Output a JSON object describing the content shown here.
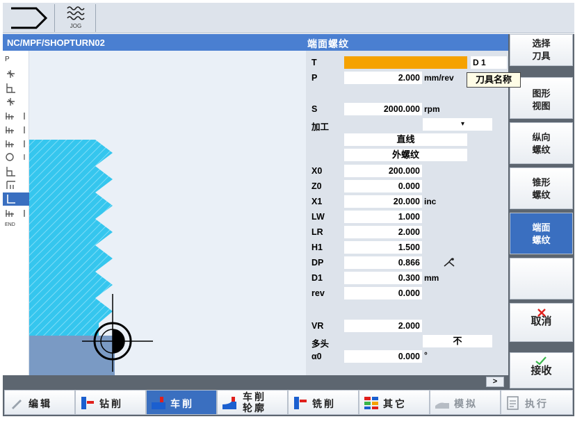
{
  "topbar": {
    "jog_label": "JOG"
  },
  "header": {
    "program_path": "NC/MPF/SHOPTURN02",
    "cycle_title": "端面螺纹"
  },
  "icon_column": {
    "first_label": "P",
    "last_label": "END"
  },
  "parameters": {
    "t_label": "T",
    "t_value": "",
    "d_label": "D 1",
    "tooltip": "刀具名称",
    "rows": [
      {
        "label": "P",
        "value": "2.000",
        "unit": "mm/rev"
      },
      {
        "label": "S",
        "value": "2000.000",
        "unit": "rpm"
      },
      {
        "label": "X0",
        "value": "200.000",
        "unit": ""
      },
      {
        "label": "Z0",
        "value": "0.000",
        "unit": ""
      },
      {
        "label": "X1",
        "value": "20.000",
        "unit": "inc"
      },
      {
        "label": "LW",
        "value": "1.000",
        "unit": ""
      },
      {
        "label": "LR",
        "value": "2.000",
        "unit": ""
      },
      {
        "label": "H1",
        "value": "1.500",
        "unit": ""
      },
      {
        "label": "DP",
        "value": "0.866",
        "unit": ""
      },
      {
        "label": "D1",
        "value": "0.300",
        "unit": "mm"
      },
      {
        "label": "rev",
        "value": "0.000",
        "unit": ""
      },
      {
        "label": "VR",
        "value": "2.000",
        "unit": ""
      },
      {
        "label": "α0",
        "value": "0.000",
        "unit": "°"
      }
    ],
    "machining_label": "加工",
    "machining_dropdown": "▾",
    "thread_type": "直线",
    "thread_position": "外螺纹",
    "multi_start_label": "多头",
    "multi_start_value": "不"
  },
  "vertical_softkeys": [
    {
      "line1": "选择",
      "line2": "刀具"
    },
    {
      "line1": "图形",
      "line2": "视图"
    },
    {
      "line1": "纵向",
      "line2": "螺纹"
    },
    {
      "line1": "锥形",
      "line2": "螺纹"
    },
    {
      "line1": "端面",
      "line2": "螺纹"
    },
    {
      "line1": "",
      "line2": ""
    },
    {
      "line1": "取消",
      "line2": ""
    },
    {
      "line1": "接收",
      "line2": ""
    }
  ],
  "status": {
    "more_label": ">"
  },
  "horizontal_softkeys": [
    {
      "label": "编辑"
    },
    {
      "label": "钻削"
    },
    {
      "label": "车削"
    },
    {
      "label1": "车削",
      "label2": "轮廓"
    },
    {
      "label": "铣削"
    },
    {
      "label": "其它"
    },
    {
      "label": "模拟"
    },
    {
      "label": "执行"
    }
  ],
  "colors": {
    "header_blue": "#4a7fd1",
    "active_blue": "#3a6fc0",
    "tool_field_orange": "#f5a200",
    "thread_cyan": "#35c6ee",
    "panel_grey": "#dde3eb"
  }
}
